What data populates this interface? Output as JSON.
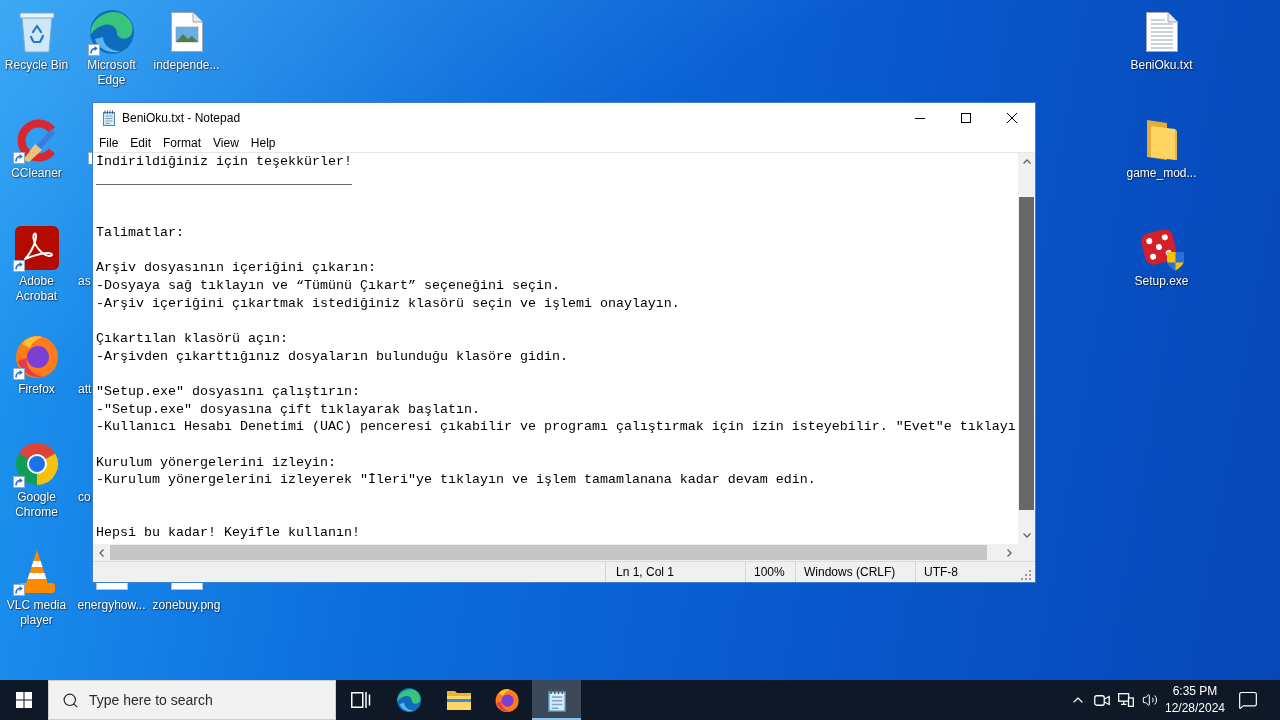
{
  "desktop": {
    "icon_columns": [
      {
        "icons": [
          {
            "kind": "recycle_bin",
            "label": "Recycle Bin",
            "shortcut": false
          },
          {
            "kind": "ccleaner",
            "label": "CCleaner",
            "shortcut": true
          },
          {
            "kind": "acrobat",
            "label": "Adobe Acrobat",
            "shortcut": true
          },
          {
            "kind": "firefox",
            "label": "Firefox",
            "shortcut": true
          },
          {
            "kind": "chrome",
            "label": "Google Chrome",
            "shortcut": true
          },
          {
            "kind": "vlc",
            "label": "VLC media player",
            "shortcut": true
          }
        ]
      },
      {
        "icons": [
          {
            "kind": "edge",
            "label": "Microsoft Edge",
            "shortcut": true
          },
          {
            "kind": "partial",
            "shortcut": true
          },
          {
            "kind": "partial",
            "label": "as"
          },
          {
            "kind": "partial",
            "label": "att"
          },
          {
            "kind": "partial",
            "label": "co"
          },
          {
            "kind": "covered",
            "label": "energyhow..."
          }
        ]
      },
      {
        "icons": [
          {
            "kind": "image_file",
            "label": "independe...",
            "shortcut": false
          },
          {
            "kind": "covered",
            "label": "zonebuy.png"
          }
        ]
      }
    ],
    "right_icons": [
      {
        "kind": "text_file",
        "label": "BeniOku.txt",
        "shortcut": false
      },
      {
        "kind": "folder",
        "label": "game_mod...",
        "shortcut": false
      },
      {
        "kind": "setup",
        "label": "Setup.exe",
        "shortcut": false
      }
    ]
  },
  "notepad": {
    "title": "BeniOku.txt - Notepad",
    "menu": [
      "File",
      "Edit",
      "Format",
      "View",
      "Help"
    ],
    "lines": [
      {
        "kind": "text",
        "text": "İndirildiğiniz için teşekkürler!"
      },
      {
        "kind": "text",
        "text": "________________________________"
      },
      {
        "kind": "blank"
      },
      {
        "kind": "blank"
      },
      {
        "kind": "text",
        "text": "Talimatlar:"
      },
      {
        "kind": "blank"
      },
      {
        "kind": "text",
        "text": "Arşiv dosyasının içeriğini çıkarın:"
      },
      {
        "kind": "text",
        "text": "-Dosyaya sağ tıklayın ve “Tümünü Çıkart” seçeneğini seçin."
      },
      {
        "kind": "text",
        "text": "-Arşiv içeriğini çıkartmak istediğiniz klasörü seçin ve işlemi onaylayın."
      },
      {
        "kind": "blank"
      },
      {
        "kind": "text",
        "text": "Çıkartılan klasörü açın:"
      },
      {
        "kind": "text",
        "text": "-Arşivden çıkarttığınız dosyaların bulunduğu klasöre gidin."
      },
      {
        "kind": "blank"
      },
      {
        "kind": "text",
        "text": "\"Setup.exe\" dosyasını çalıştırın:"
      },
      {
        "kind": "text",
        "text": "-\"Setup.exe\" dosyasına çift tıklayarak başlatın."
      },
      {
        "kind": "text",
        "text": "-Kullanıcı Hesabı Denetimi (UAC) penceresi çıkabilir ve programı çalıştırmak için izin isteyebilir. \"Evet\"e tıklayı"
      },
      {
        "kind": "blank"
      },
      {
        "kind": "text",
        "text": "Kurulum yönergelerini izleyin:"
      },
      {
        "kind": "text",
        "text": "-Kurulum yönergelerini izleyerek \"İleri\"ye tıklayın ve işlem tamamlanana kadar devam edin."
      },
      {
        "kind": "blank"
      },
      {
        "kind": "blank"
      },
      {
        "kind": "text",
        "text": "Hepsi bu kadar! Keyifle kullanın!"
      }
    ],
    "status": [
      "Ln 1, Col 1",
      "100%",
      "Windows (CRLF)",
      "UTF-8"
    ]
  },
  "taskbar": {
    "search": {
      "placeholder": "Type here to search"
    },
    "apps": [
      {
        "kind": "edge",
        "selected": false
      },
      {
        "kind": "explorer",
        "selected": false
      },
      {
        "kind": "firefox",
        "selected": false
      },
      {
        "kind": "notepad",
        "selected": true
      }
    ],
    "clock": {
      "time": "6:35 PM",
      "date": "12/28/2024"
    }
  }
}
